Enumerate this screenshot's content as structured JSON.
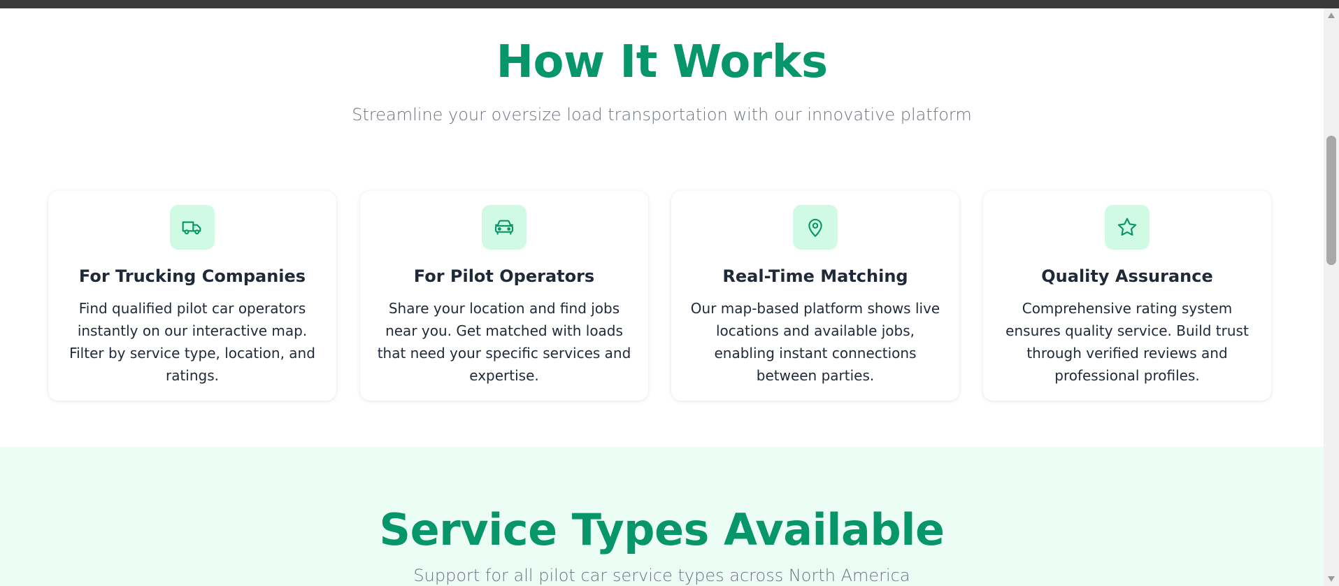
{
  "how_it_works": {
    "title": "How It Works",
    "subtitle": "Streamline your oversize load transportation with our innovative platform",
    "cards": [
      {
        "icon": "truck-icon",
        "title": "For Trucking Companies",
        "text": "Find qualified pilot car operators instantly on our interactive map. Filter by service type, location, and ratings."
      },
      {
        "icon": "car-icon",
        "title": "For Pilot Operators",
        "text": "Share your location and find jobs near you. Get matched with loads that need your specific services and expertise."
      },
      {
        "icon": "map-pin-icon",
        "title": "Real-Time Matching",
        "text": "Our map-based platform shows live locations and available jobs, enabling instant connections between parties."
      },
      {
        "icon": "star-icon",
        "title": "Quality Assurance",
        "text": "Comprehensive rating system ensures quality service. Build trust through verified reviews and professional profiles."
      }
    ]
  },
  "service_types": {
    "title": "Service Types Available",
    "subtitle": "Support for all pilot car service types across North America"
  },
  "colors": {
    "accent": "#079669",
    "icon_bg": "#d1fae5",
    "section_bg": "#ecfdf5",
    "heading_text": "#1f2937",
    "muted_text": "#6b7280"
  }
}
